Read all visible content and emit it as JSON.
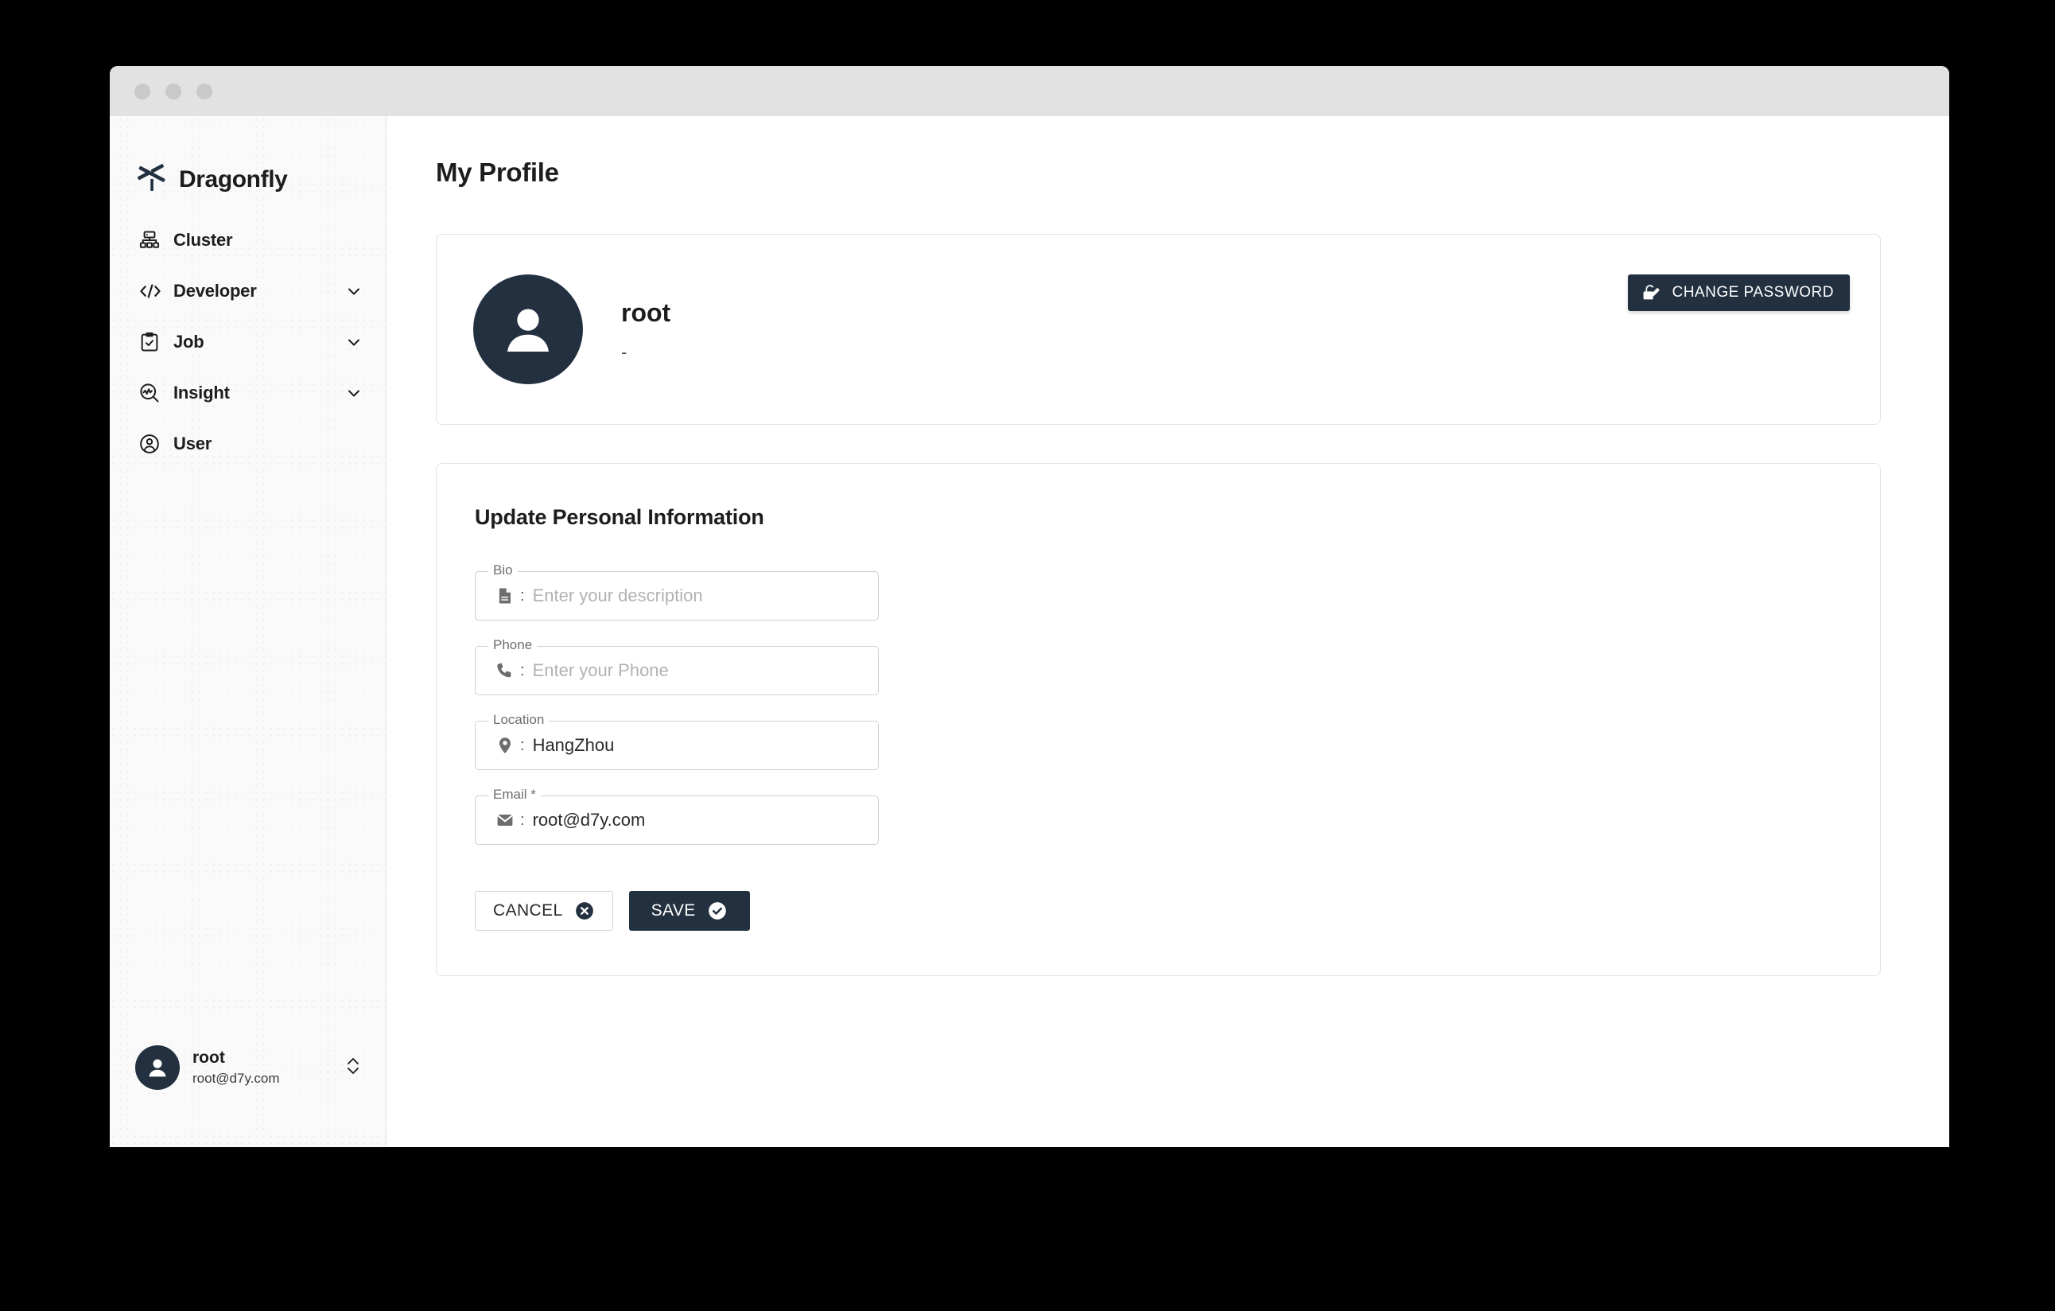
{
  "window": {
    "traffic_lights": [
      "close",
      "minimize",
      "maximize"
    ]
  },
  "brand": {
    "name": "Dragonfly",
    "logo_icon": "dragonfly-logo-icon"
  },
  "sidebar": {
    "items": [
      {
        "label": "Cluster",
        "icon": "cluster-icon",
        "expandable": false
      },
      {
        "label": "Developer",
        "icon": "code-icon",
        "expandable": true
      },
      {
        "label": "Job",
        "icon": "clipboard-check-icon",
        "expandable": true
      },
      {
        "label": "Insight",
        "icon": "insight-search-icon",
        "expandable": true
      },
      {
        "label": "User",
        "icon": "user-circle-icon",
        "expandable": false
      }
    ],
    "account": {
      "name": "root",
      "email": "root@d7y.com",
      "avatar_icon": "person-icon",
      "caret_icon": "chevron-up-down-icon"
    }
  },
  "main": {
    "page_title": "My Profile",
    "profile": {
      "avatar_icon": "person-icon",
      "name": "root",
      "subtitle": "-",
      "change_password_label": "CHANGE PASSWORD",
      "change_password_icon": "lock-edit-icon"
    },
    "form": {
      "title": "Update Personal Information",
      "fields": [
        {
          "legend": "Bio",
          "icon": "description-icon",
          "value": "",
          "placeholder": "Enter your description"
        },
        {
          "legend": "Phone",
          "icon": "phone-icon",
          "value": "",
          "placeholder": "Enter your Phone"
        },
        {
          "legend": "Location",
          "icon": "location-pin-icon",
          "value": "HangZhou",
          "placeholder": ""
        },
        {
          "legend": "Email *",
          "icon": "mail-icon",
          "value": "root@d7y.com",
          "placeholder": ""
        }
      ],
      "cancel_label": "CANCEL",
      "cancel_icon": "cancel-circle-icon",
      "save_label": "SAVE",
      "save_icon": "check-circle-icon"
    }
  },
  "colors": {
    "accent_dark": "#22303f",
    "titlebar": "#e2e2e2",
    "sidebar_bg": "#fafafa",
    "card_border": "#e3e3e3",
    "text_primary": "#1d1d1f",
    "placeholder": "#b2b2b2"
  }
}
